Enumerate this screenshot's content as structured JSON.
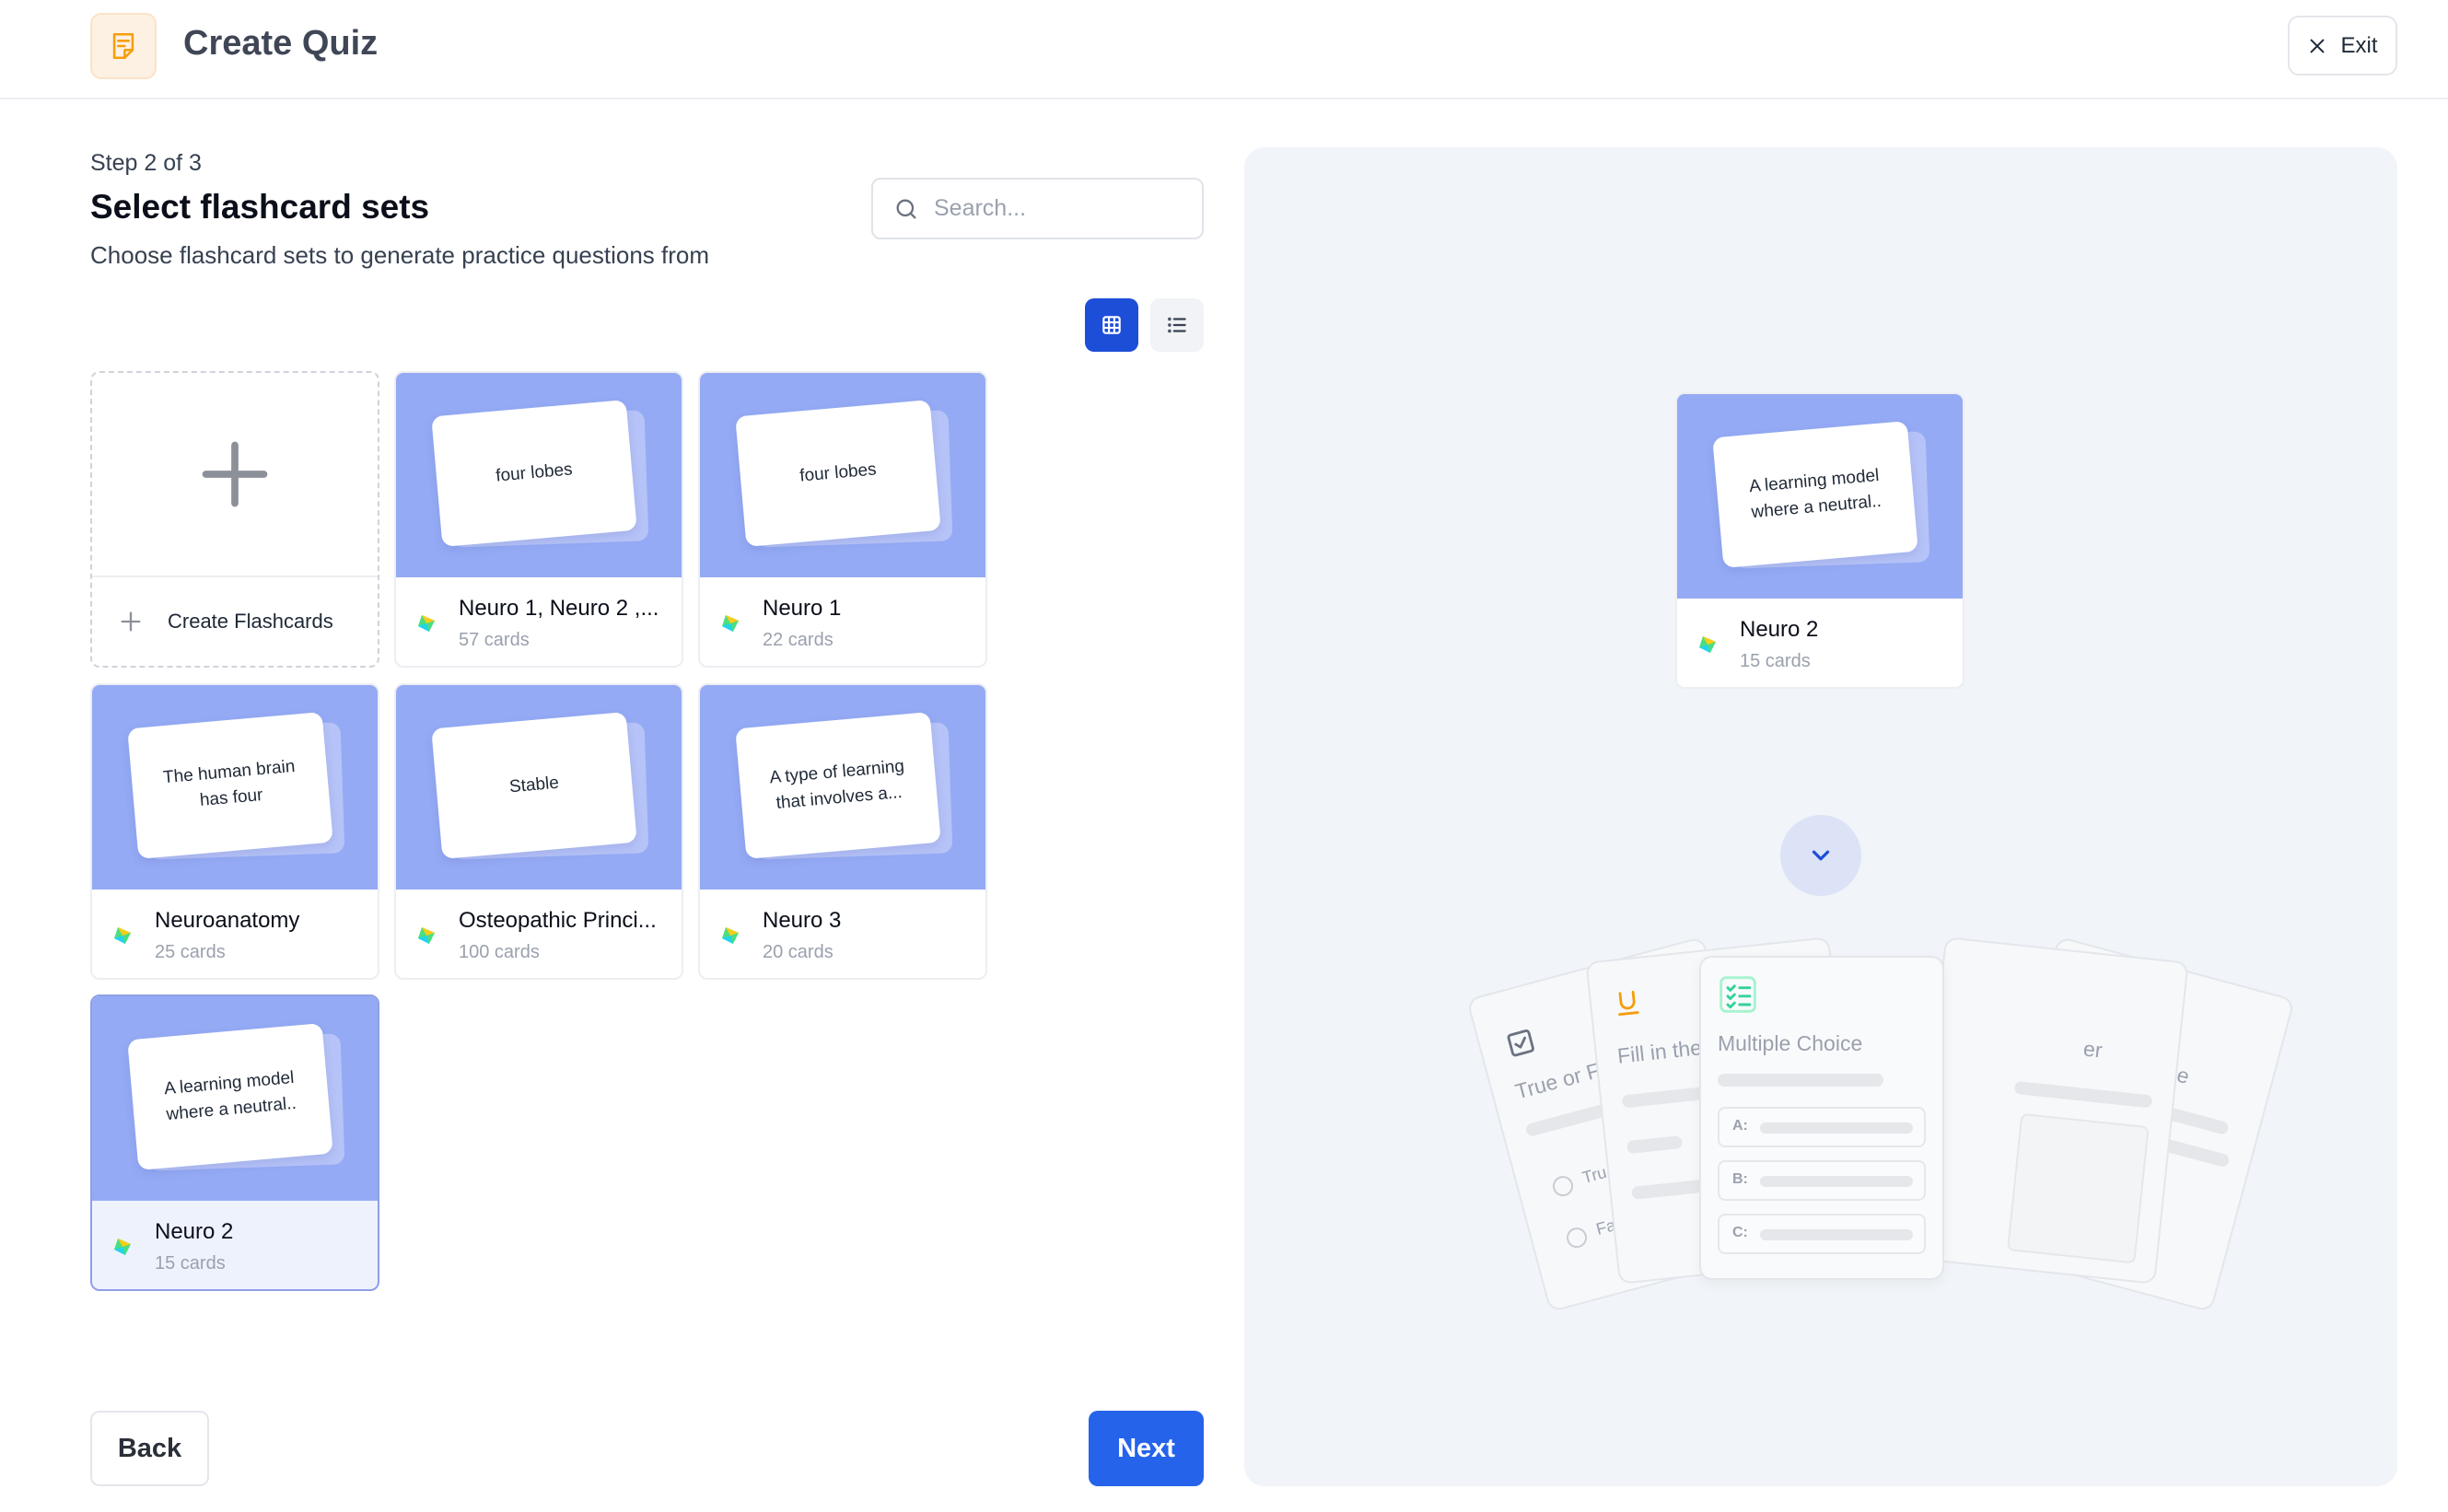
{
  "header": {
    "title": "Create Quiz",
    "exit_label": "Exit",
    "icon": "document-icon",
    "icon_color": "#f59e0b"
  },
  "step": {
    "label": "Step 2 of 3",
    "title": "Select flashcard sets",
    "subtitle": "Choose flashcard sets to generate practice questions from"
  },
  "search": {
    "placeholder": "Search...",
    "value": ""
  },
  "view_toggle": {
    "active": "grid",
    "options": [
      "grid",
      "list"
    ]
  },
  "create_card": {
    "label": "Create Flashcards"
  },
  "sets": [
    {
      "name": "Neuro 1, Neuro 2 ,...",
      "count": "57 cards",
      "preview": "four lobes",
      "selected": false
    },
    {
      "name": "Neuro 1",
      "count": "22 cards",
      "preview": "four lobes",
      "selected": false
    },
    {
      "name": "Neuroanatomy",
      "count": "25 cards",
      "preview": "The human brain has four",
      "selected": false
    },
    {
      "name": "Osteopathic Princi...",
      "count": "100 cards",
      "preview": "Stable",
      "selected": false
    },
    {
      "name": "Neuro 3",
      "count": "20 cards",
      "preview": "A type of learning that involves a...",
      "selected": false
    },
    {
      "name": "Neuro 2",
      "count": "15 cards",
      "preview": "A learning model where a neutral..",
      "selected": true
    }
  ],
  "preview": {
    "set_name": "Neuro 2",
    "set_count": "15 cards",
    "card_text": "A learning model where a neutral..",
    "question_types": [
      {
        "title": "True or False",
        "visible_text": "True or F"
      },
      {
        "title": "Fill in the Blank",
        "visible_text": "Fill in the"
      },
      {
        "title": "Multiple Choice",
        "visible_text": "Multiple Choice"
      },
      {
        "title": "Short Answer",
        "visible_text": "er"
      },
      {
        "title": "True or False",
        "visible_text": "se"
      }
    ],
    "tf_options": [
      "Tru",
      "Fal"
    ],
    "mc_options": [
      "A:",
      "B:",
      "C:"
    ]
  },
  "footer": {
    "back_label": "Back",
    "next_label": "Next"
  },
  "colors": {
    "accent": "#2563eb",
    "card_header": "#95aaf4",
    "panel_bg": "#f1f4f8",
    "selected_bg": "#eef2fd"
  }
}
